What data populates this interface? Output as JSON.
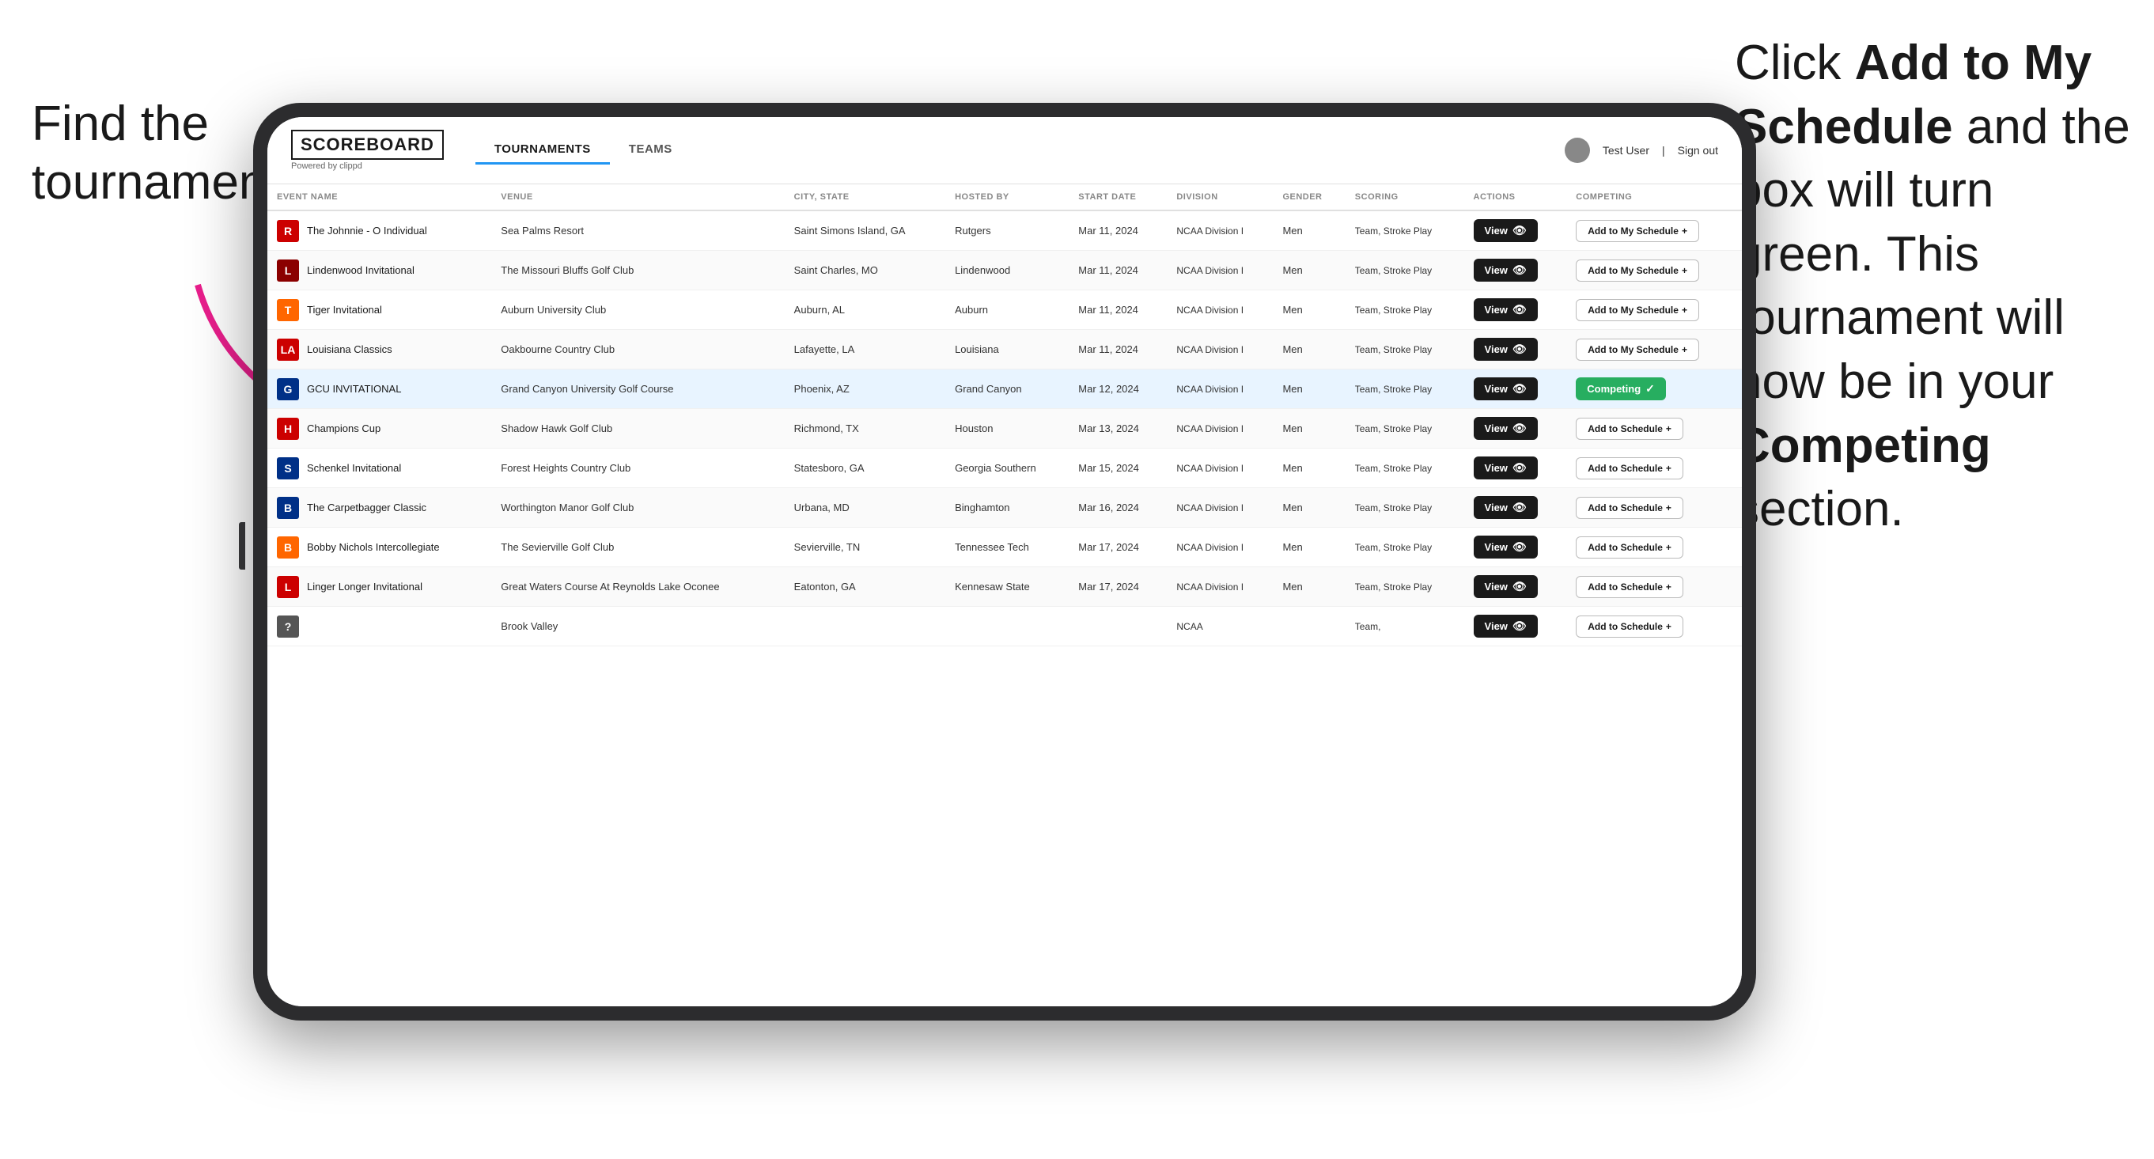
{
  "annotations": {
    "left": "Find the tournament.",
    "right_line1": "Click ",
    "right_bold1": "Add to My Schedule",
    "right_line2": " and the box will turn green. This tournament will now be in your ",
    "right_bold2": "Competing",
    "right_line3": " section."
  },
  "header": {
    "logo": "SCOREBOARD",
    "logo_sub": "Powered by clippd",
    "nav_tabs": [
      "TOURNAMENTS",
      "TEAMS"
    ],
    "active_tab": "TOURNAMENTS",
    "user_label": "Test User",
    "sign_out": "Sign out"
  },
  "table": {
    "columns": [
      "EVENT NAME",
      "VENUE",
      "CITY, STATE",
      "HOSTED BY",
      "START DATE",
      "DIVISION",
      "GENDER",
      "SCORING",
      "ACTIONS",
      "COMPETING"
    ],
    "rows": [
      {
        "logo_color": "#cc0000",
        "logo_letter": "R",
        "event": "The Johnnie - O Individual",
        "venue": "Sea Palms Resort",
        "city": "Saint Simons Island, GA",
        "hosted_by": "Rutgers",
        "date": "Mar 11, 2024",
        "division": "NCAA Division I",
        "gender": "Men",
        "scoring": "Team, Stroke Play",
        "action": "View",
        "competing_label": "Add to My Schedule",
        "is_competing": false,
        "highlighted": false
      },
      {
        "logo_color": "#8B0000",
        "logo_letter": "L",
        "event": "Lindenwood Invitational",
        "venue": "The Missouri Bluffs Golf Club",
        "city": "Saint Charles, MO",
        "hosted_by": "Lindenwood",
        "date": "Mar 11, 2024",
        "division": "NCAA Division I",
        "gender": "Men",
        "scoring": "Team, Stroke Play",
        "action": "View",
        "competing_label": "Add to My Schedule",
        "is_competing": false,
        "highlighted": false
      },
      {
        "logo_color": "#FF6600",
        "logo_letter": "T",
        "event": "Tiger Invitational",
        "venue": "Auburn University Club",
        "city": "Auburn, AL",
        "hosted_by": "Auburn",
        "date": "Mar 11, 2024",
        "division": "NCAA Division I",
        "gender": "Men",
        "scoring": "Team, Stroke Play",
        "action": "View",
        "competing_label": "Add to My Schedule",
        "is_competing": false,
        "highlighted": false
      },
      {
        "logo_color": "#cc0000",
        "logo_letter": "LA",
        "event": "Louisiana Classics",
        "venue": "Oakbourne Country Club",
        "city": "Lafayette, LA",
        "hosted_by": "Louisiana",
        "date": "Mar 11, 2024",
        "division": "NCAA Division I",
        "gender": "Men",
        "scoring": "Team, Stroke Play",
        "action": "View",
        "competing_label": "Add to My Schedule",
        "is_competing": false,
        "highlighted": false
      },
      {
        "logo_color": "#003087",
        "logo_letter": "G",
        "event": "GCU INVITATIONAL",
        "venue": "Grand Canyon University Golf Course",
        "city": "Phoenix, AZ",
        "hosted_by": "Grand Canyon",
        "date": "Mar 12, 2024",
        "division": "NCAA Division I",
        "gender": "Men",
        "scoring": "Team, Stroke Play",
        "action": "View",
        "competing_label": "Competing",
        "is_competing": true,
        "highlighted": true
      },
      {
        "logo_color": "#cc0000",
        "logo_letter": "H",
        "event": "Champions Cup",
        "venue": "Shadow Hawk Golf Club",
        "city": "Richmond, TX",
        "hosted_by": "Houston",
        "date": "Mar 13, 2024",
        "division": "NCAA Division I",
        "gender": "Men",
        "scoring": "Team, Stroke Play",
        "action": "View",
        "competing_label": "Add to Schedule",
        "is_competing": false,
        "highlighted": false
      },
      {
        "logo_color": "#003087",
        "logo_letter": "S",
        "event": "Schenkel Invitational",
        "venue": "Forest Heights Country Club",
        "city": "Statesboro, GA",
        "hosted_by": "Georgia Southern",
        "date": "Mar 15, 2024",
        "division": "NCAA Division I",
        "gender": "Men",
        "scoring": "Team, Stroke Play",
        "action": "View",
        "competing_label": "Add to Schedule",
        "is_competing": false,
        "highlighted": false
      },
      {
        "logo_color": "#003087",
        "logo_letter": "B",
        "event": "The Carpetbagger Classic",
        "venue": "Worthington Manor Golf Club",
        "city": "Urbana, MD",
        "hosted_by": "Binghamton",
        "date": "Mar 16, 2024",
        "division": "NCAA Division I",
        "gender": "Men",
        "scoring": "Team, Stroke Play",
        "action": "View",
        "competing_label": "Add to Schedule",
        "is_competing": false,
        "highlighted": false
      },
      {
        "logo_color": "#FF6600",
        "logo_letter": "B",
        "event": "Bobby Nichols Intercollegiate",
        "venue": "The Sevierville Golf Club",
        "city": "Sevierville, TN",
        "hosted_by": "Tennessee Tech",
        "date": "Mar 17, 2024",
        "division": "NCAA Division I",
        "gender": "Men",
        "scoring": "Team, Stroke Play",
        "action": "View",
        "competing_label": "Add to Schedule",
        "is_competing": false,
        "highlighted": false
      },
      {
        "logo_color": "#cc0000",
        "logo_letter": "L",
        "event": "Linger Longer Invitational",
        "venue": "Great Waters Course At Reynolds Lake Oconee",
        "city": "Eatonton, GA",
        "hosted_by": "Kennesaw State",
        "date": "Mar 17, 2024",
        "division": "NCAA Division I",
        "gender": "Men",
        "scoring": "Team, Stroke Play",
        "action": "View",
        "competing_label": "Add to Schedule",
        "is_competing": false,
        "highlighted": false
      },
      {
        "logo_color": "#555",
        "logo_letter": "?",
        "event": "",
        "venue": "Brook Valley",
        "city": "",
        "hosted_by": "",
        "date": "",
        "division": "NCAA",
        "gender": "",
        "scoring": "Team,",
        "action": "View",
        "competing_label": "Add to Schedule",
        "is_competing": false,
        "highlighted": false
      }
    ]
  }
}
